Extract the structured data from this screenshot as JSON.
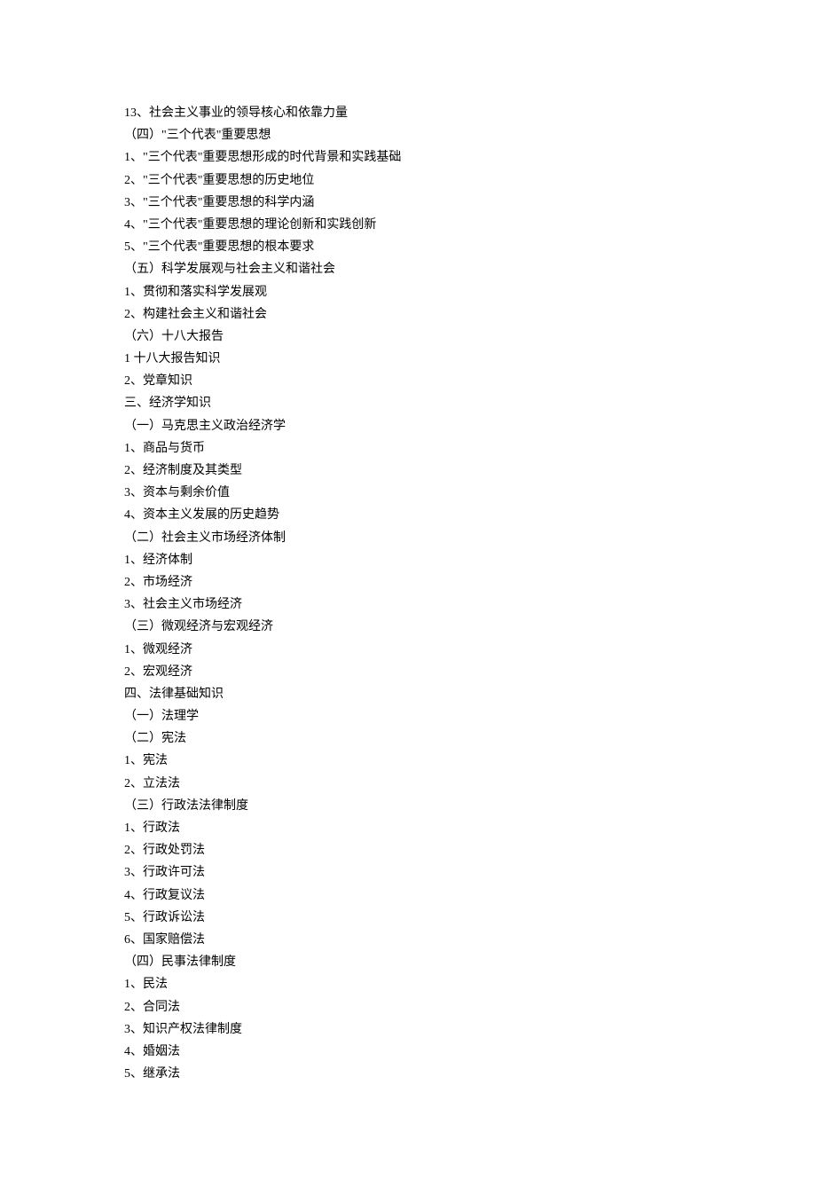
{
  "lines": [
    "13、社会主义事业的领导核心和依靠力量",
    "（四）\"三个代表\"重要思想",
    "1、\"三个代表\"重要思想形成的时代背景和实践基础",
    "2、\"三个代表\"重要思想的历史地位",
    "3、\"三个代表\"重要思想的科学内涵",
    "4、\"三个代表\"重要思想的理论创新和实践创新",
    "5、\"三个代表\"重要思想的根本要求",
    "（五）科学发展观与社会主义和谐社会",
    "1、贯彻和落实科学发展观",
    "2、构建社会主义和谐社会",
    "（六）十八大报告",
    "1 十八大报告知识",
    "2、党章知识",
    "三、经济学知识",
    "（一）马克思主义政治经济学",
    "1、商品与货币",
    "2、经济制度及其类型",
    "3、资本与剩余价值",
    "4、资本主义发展的历史趋势",
    "（二）社会主义市场经济体制",
    "1、经济体制",
    "2、市场经济",
    "3、社会主义市场经济",
    "（三）微观经济与宏观经济",
    "1、微观经济",
    "2、宏观经济",
    "四、法律基础知识",
    "（一）法理学",
    "（二）宪法",
    "1、宪法",
    "2、立法法",
    "（三）行政法法律制度",
    "1、行政法",
    "2、行政处罚法",
    "3、行政许可法",
    "4、行政复议法",
    "5、行政诉讼法",
    "6、国家赔偿法",
    "（四）民事法律制度",
    "1、民法",
    "2、合同法",
    "3、知识产权法律制度",
    "4、婚姻法",
    "5、继承法"
  ]
}
